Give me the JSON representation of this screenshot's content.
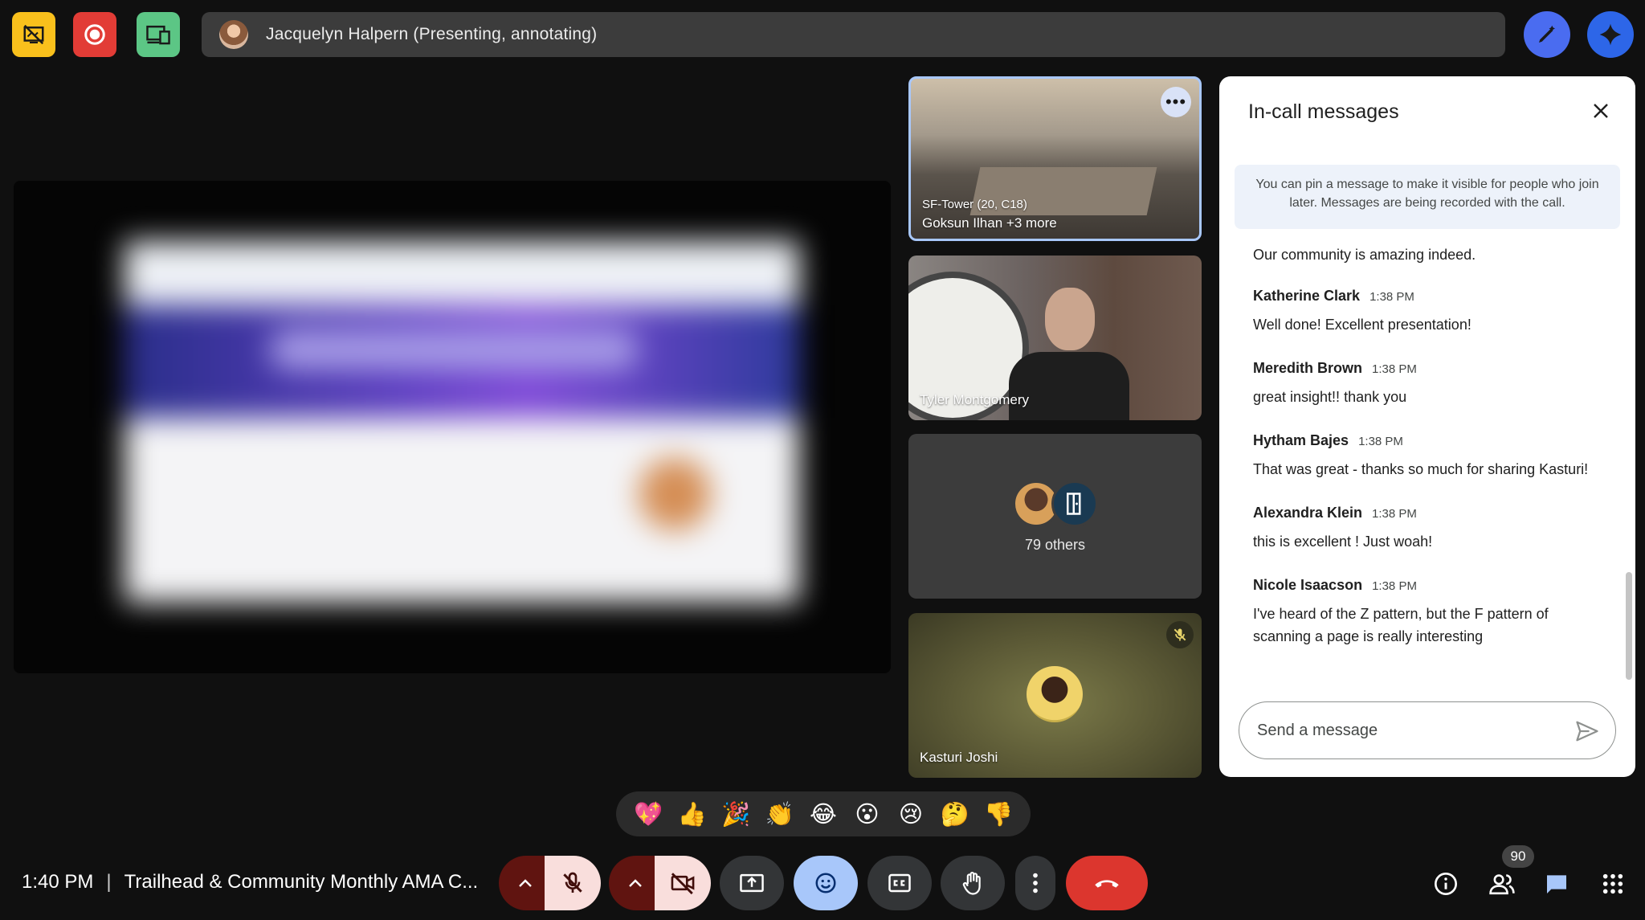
{
  "top_bar": {
    "presenter_label": "Jacquelyn Halpern (Presenting, annotating)"
  },
  "tiles": [
    {
      "line1": "SF-Tower (20, C18)",
      "line2": "Goksun Ilhan +3 more",
      "more_icon": "more-horiz-icon"
    },
    {
      "name": "Tyler Montgomery"
    },
    {
      "others": "79 others"
    },
    {
      "name": "Kasturi Joshi",
      "muted": true
    }
  ],
  "chat": {
    "title": "In-call messages",
    "pin_notice": "You can pin a message to make it visible for people who join later. Messages are being recorded with the call.",
    "previous_text": "Our community is amazing indeed.",
    "messages": [
      {
        "sender": "Katherine Clark",
        "time": "1:38 PM",
        "text": "Well done! Excellent presentation!"
      },
      {
        "sender": "Meredith Brown",
        "time": "1:38 PM",
        "text": "great insight!! thank you"
      },
      {
        "sender": "Hytham Bajes",
        "time": "1:38 PM",
        "text": "That was great - thanks so much for sharing Kasturi!"
      },
      {
        "sender": "Alexandra Klein",
        "time": "1:38 PM",
        "text": "this is excellent ! Just woah!"
      },
      {
        "sender": "Nicole Isaacson",
        "time": "1:38 PM",
        "text": "I've heard of the Z pattern, but the F pattern of scanning a page is really interesting"
      }
    ],
    "input_placeholder": "Send a message"
  },
  "reactions": [
    "💖",
    "👍",
    "🎉",
    "👏",
    "😂",
    "😮",
    "😢",
    "🤔",
    "👎"
  ],
  "bottom_bar": {
    "time": "1:40 PM",
    "separator": "|",
    "meeting_title": "Trailhead & Community Monthly AMA C...",
    "people_count": "90"
  },
  "colors": {
    "background": "#101010",
    "end_call": "#dc362e",
    "active_blue": "#a8c7fa",
    "mic_off": "#f9dedc"
  }
}
